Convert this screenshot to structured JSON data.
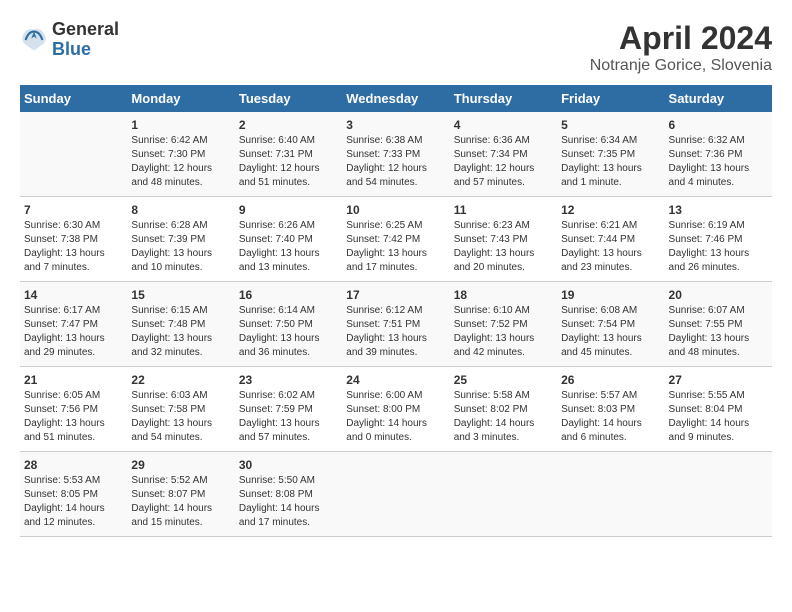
{
  "header": {
    "logo_general": "General",
    "logo_blue": "Blue",
    "title": "April 2024",
    "subtitle": "Notranje Gorice, Slovenia"
  },
  "calendar": {
    "days_of_week": [
      "Sunday",
      "Monday",
      "Tuesday",
      "Wednesday",
      "Thursday",
      "Friday",
      "Saturday"
    ],
    "weeks": [
      [
        {
          "day": "",
          "info": ""
        },
        {
          "day": "1",
          "info": "Sunrise: 6:42 AM\nSunset: 7:30 PM\nDaylight: 12 hours\nand 48 minutes."
        },
        {
          "day": "2",
          "info": "Sunrise: 6:40 AM\nSunset: 7:31 PM\nDaylight: 12 hours\nand 51 minutes."
        },
        {
          "day": "3",
          "info": "Sunrise: 6:38 AM\nSunset: 7:33 PM\nDaylight: 12 hours\nand 54 minutes."
        },
        {
          "day": "4",
          "info": "Sunrise: 6:36 AM\nSunset: 7:34 PM\nDaylight: 12 hours\nand 57 minutes."
        },
        {
          "day": "5",
          "info": "Sunrise: 6:34 AM\nSunset: 7:35 PM\nDaylight: 13 hours\nand 1 minute."
        },
        {
          "day": "6",
          "info": "Sunrise: 6:32 AM\nSunset: 7:36 PM\nDaylight: 13 hours\nand 4 minutes."
        }
      ],
      [
        {
          "day": "7",
          "info": "Sunrise: 6:30 AM\nSunset: 7:38 PM\nDaylight: 13 hours\nand 7 minutes."
        },
        {
          "day": "8",
          "info": "Sunrise: 6:28 AM\nSunset: 7:39 PM\nDaylight: 13 hours\nand 10 minutes."
        },
        {
          "day": "9",
          "info": "Sunrise: 6:26 AM\nSunset: 7:40 PM\nDaylight: 13 hours\nand 13 minutes."
        },
        {
          "day": "10",
          "info": "Sunrise: 6:25 AM\nSunset: 7:42 PM\nDaylight: 13 hours\nand 17 minutes."
        },
        {
          "day": "11",
          "info": "Sunrise: 6:23 AM\nSunset: 7:43 PM\nDaylight: 13 hours\nand 20 minutes."
        },
        {
          "day": "12",
          "info": "Sunrise: 6:21 AM\nSunset: 7:44 PM\nDaylight: 13 hours\nand 23 minutes."
        },
        {
          "day": "13",
          "info": "Sunrise: 6:19 AM\nSunset: 7:46 PM\nDaylight: 13 hours\nand 26 minutes."
        }
      ],
      [
        {
          "day": "14",
          "info": "Sunrise: 6:17 AM\nSunset: 7:47 PM\nDaylight: 13 hours\nand 29 minutes."
        },
        {
          "day": "15",
          "info": "Sunrise: 6:15 AM\nSunset: 7:48 PM\nDaylight: 13 hours\nand 32 minutes."
        },
        {
          "day": "16",
          "info": "Sunrise: 6:14 AM\nSunset: 7:50 PM\nDaylight: 13 hours\nand 36 minutes."
        },
        {
          "day": "17",
          "info": "Sunrise: 6:12 AM\nSunset: 7:51 PM\nDaylight: 13 hours\nand 39 minutes."
        },
        {
          "day": "18",
          "info": "Sunrise: 6:10 AM\nSunset: 7:52 PM\nDaylight: 13 hours\nand 42 minutes."
        },
        {
          "day": "19",
          "info": "Sunrise: 6:08 AM\nSunset: 7:54 PM\nDaylight: 13 hours\nand 45 minutes."
        },
        {
          "day": "20",
          "info": "Sunrise: 6:07 AM\nSunset: 7:55 PM\nDaylight: 13 hours\nand 48 minutes."
        }
      ],
      [
        {
          "day": "21",
          "info": "Sunrise: 6:05 AM\nSunset: 7:56 PM\nDaylight: 13 hours\nand 51 minutes."
        },
        {
          "day": "22",
          "info": "Sunrise: 6:03 AM\nSunset: 7:58 PM\nDaylight: 13 hours\nand 54 minutes."
        },
        {
          "day": "23",
          "info": "Sunrise: 6:02 AM\nSunset: 7:59 PM\nDaylight: 13 hours\nand 57 minutes."
        },
        {
          "day": "24",
          "info": "Sunrise: 6:00 AM\nSunset: 8:00 PM\nDaylight: 14 hours\nand 0 minutes."
        },
        {
          "day": "25",
          "info": "Sunrise: 5:58 AM\nSunset: 8:02 PM\nDaylight: 14 hours\nand 3 minutes."
        },
        {
          "day": "26",
          "info": "Sunrise: 5:57 AM\nSunset: 8:03 PM\nDaylight: 14 hours\nand 6 minutes."
        },
        {
          "day": "27",
          "info": "Sunrise: 5:55 AM\nSunset: 8:04 PM\nDaylight: 14 hours\nand 9 minutes."
        }
      ],
      [
        {
          "day": "28",
          "info": "Sunrise: 5:53 AM\nSunset: 8:05 PM\nDaylight: 14 hours\nand 12 minutes."
        },
        {
          "day": "29",
          "info": "Sunrise: 5:52 AM\nSunset: 8:07 PM\nDaylight: 14 hours\nand 15 minutes."
        },
        {
          "day": "30",
          "info": "Sunrise: 5:50 AM\nSunset: 8:08 PM\nDaylight: 14 hours\nand 17 minutes."
        },
        {
          "day": "",
          "info": ""
        },
        {
          "day": "",
          "info": ""
        },
        {
          "day": "",
          "info": ""
        },
        {
          "day": "",
          "info": ""
        }
      ]
    ]
  }
}
